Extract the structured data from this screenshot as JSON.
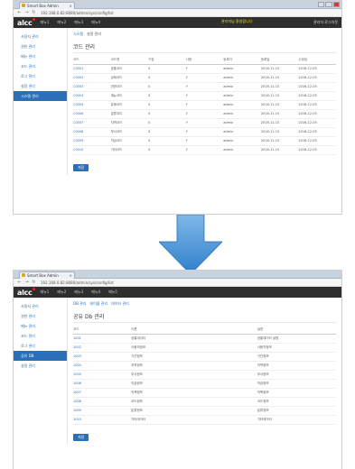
{
  "top": {
    "tab_title": "Smart Box Admin",
    "address": "192.168.0.82:8080/admin/sys/config/list",
    "menu": [
      "메뉴1",
      "메뉴2",
      "메뉴3",
      "메뉴4"
    ],
    "nav_highlight": "관리자님 환영합니다",
    "nav_right": "관리자  로그아웃",
    "sidebar": [
      "사용자 관리",
      "권한 관리",
      "메뉴 관리",
      "코드 관리",
      "로그 관리",
      "설정 관리",
      "시스템 관리"
    ],
    "subtabs": [
      "시스템",
      "설정 관리"
    ],
    "title": "코드 관리",
    "columns": [
      "코드",
      "코드명",
      "구분",
      "사용",
      "등록자",
      "등록일",
      "수정일"
    ],
    "rows": [
      [
        "C0001",
        "공통코드",
        "S",
        "Y",
        "admin",
        "2016-11-15",
        "2016-12-05"
      ],
      [
        "C0002",
        "상태코드",
        "S",
        "Y",
        "admin",
        "2016-11-15",
        "2016-12-05"
      ],
      [
        "C0003",
        "권한코드",
        "S",
        "Y",
        "admin",
        "2016-11-15",
        "2016-12-05"
      ],
      [
        "C0004",
        "메뉴코드",
        "S",
        "Y",
        "admin",
        "2016-11-15",
        "2016-12-05"
      ],
      [
        "C0005",
        "유형코드",
        "S",
        "Y",
        "admin",
        "2016-11-15",
        "2016-12-05"
      ],
      [
        "C0006",
        "분류코드",
        "S",
        "Y",
        "admin",
        "2016-11-15",
        "2016-12-05"
      ],
      [
        "C0007",
        "지역코드",
        "S",
        "Y",
        "admin",
        "2016-11-15",
        "2016-12-05"
      ],
      [
        "C0008",
        "부서코드",
        "S",
        "Y",
        "admin",
        "2016-11-15",
        "2016-12-05"
      ],
      [
        "C0009",
        "직급코드",
        "S",
        "Y",
        "admin",
        "2016-11-15",
        "2016-12-05"
      ],
      [
        "C0010",
        "기타코드",
        "S",
        "Y",
        "admin",
        "2016-11-15",
        "2016-12-05"
      ]
    ],
    "save_label": "저장"
  },
  "bottom": {
    "tab_title": "Smart Box Admin",
    "address": "192.168.0.82:8080/admin/sys/config/list",
    "menu": [
      "메뉴1",
      "메뉴2",
      "메뉴3",
      "메뉴4",
      "메뉴5"
    ],
    "sidebar": [
      "사용자 관리",
      "권한 관리",
      "메뉴 관리",
      "코드 관리",
      "로그 관리",
      "공유 DB",
      "설정 관리"
    ],
    "subtabs": [
      "DB 관리",
      "테이블 관리",
      "데이터 관리"
    ],
    "title": "공유 Db 관리",
    "columns": [
      "코드",
      "이름",
      "설명"
    ],
    "rows": [
      [
        "1001",
        "공통데이터",
        "공통데이터 설명"
      ],
      [
        "1002",
        "사용자정보",
        "사용자정보"
      ],
      [
        "1003",
        "기관정보",
        "기관정보"
      ],
      [
        "1004",
        "지역정보",
        "지역정보"
      ],
      [
        "1005",
        "부서정보",
        "부서정보"
      ],
      [
        "1006",
        "직급정보",
        "직급정보"
      ],
      [
        "1007",
        "직책정보",
        "직책정보"
      ],
      [
        "1008",
        "코드정보",
        "코드정보"
      ],
      [
        "1009",
        "분류정보",
        "분류정보"
      ],
      [
        "1010",
        "기타데이터",
        "기타데이터"
      ]
    ],
    "save_label": "저장"
  },
  "colors": {
    "accent": "#2a6fb7",
    "nav_bg": "#2e2e2e",
    "highlight": "#f4e300",
    "arrow": "#3e8fd6"
  },
  "icons": {
    "arrow": "down-arrow-icon"
  }
}
